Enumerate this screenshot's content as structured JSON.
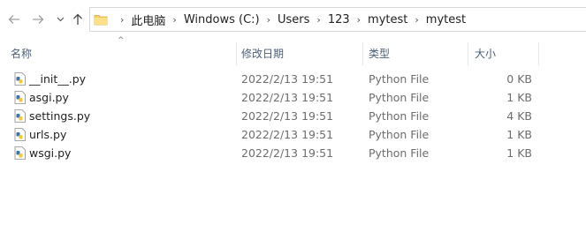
{
  "nav": {
    "back_icon": "arrow-left-icon",
    "forward_icon": "arrow-right-icon",
    "recent_icon": "chevron-down-icon",
    "up_icon": "arrow-up-icon"
  },
  "breadcrumb": [
    "此电脑",
    "Windows (C:)",
    "Users",
    "123",
    "mytest",
    "mytest"
  ],
  "columns": {
    "name": "名称",
    "date": "修改日期",
    "type": "类型",
    "size": "大小"
  },
  "files": [
    {
      "name": "__init__.py",
      "date": "2022/2/13 19:51",
      "type": "Python File",
      "size": "0 KB"
    },
    {
      "name": "asgi.py",
      "date": "2022/2/13 19:51",
      "type": "Python File",
      "size": "1 KB"
    },
    {
      "name": "settings.py",
      "date": "2022/2/13 19:51",
      "type": "Python File",
      "size": "4 KB"
    },
    {
      "name": "urls.py",
      "date": "2022/2/13 19:51",
      "type": "Python File",
      "size": "1 KB"
    },
    {
      "name": "wsgi.py",
      "date": "2022/2/13 19:51",
      "type": "Python File",
      "size": "1 KB"
    }
  ]
}
